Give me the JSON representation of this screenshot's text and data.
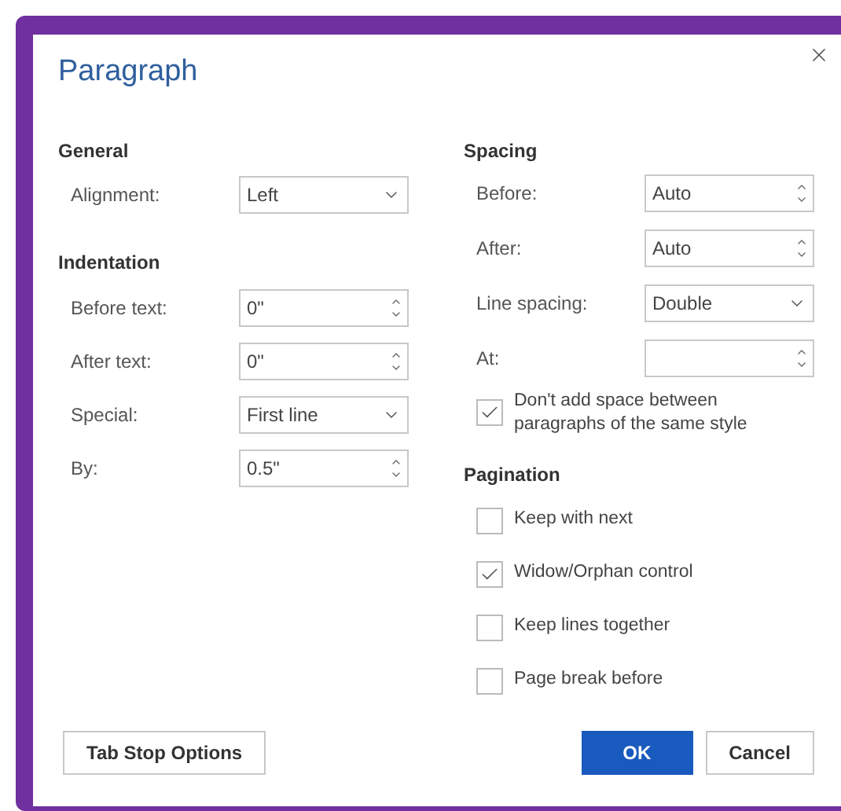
{
  "dialog": {
    "title": "Paragraph"
  },
  "general": {
    "heading": "General",
    "fields": [
      {
        "label": "Alignment:",
        "value": "Left",
        "kind": "dropdown"
      }
    ]
  },
  "indentation": {
    "heading": "Indentation",
    "fields": [
      {
        "label": "Before text:",
        "value": "0\"",
        "kind": "spin"
      },
      {
        "label": "After text:",
        "value": "0\"",
        "kind": "spin"
      },
      {
        "label": "Special:",
        "value": "First line",
        "kind": "dropdown"
      },
      {
        "label": "By:",
        "value": "0.5\"",
        "kind": "spin"
      }
    ]
  },
  "spacing": {
    "heading": "Spacing",
    "fields": [
      {
        "label": "Before:",
        "value": "Auto",
        "kind": "spin"
      },
      {
        "label": "After:",
        "value": "Auto",
        "kind": "spin"
      },
      {
        "label": "Line spacing:",
        "value": "Double",
        "kind": "dropdown"
      },
      {
        "label": "At:",
        "kind": "spin"
      }
    ],
    "option": {
      "label": "Don't add space between paragraphs of the same style",
      "checked": true
    }
  },
  "pagination": {
    "heading": "Pagination",
    "options": [
      {
        "label": "Keep with next",
        "checked": false
      },
      {
        "label": "Widow/Orphan control",
        "checked": true
      },
      {
        "label": "Keep lines together",
        "checked": false
      },
      {
        "label": "Page break before",
        "checked": false
      }
    ]
  },
  "buttons": [
    {
      "label": "Tab Stop Options",
      "kind": "secondary"
    },
    {
      "label": "OK",
      "kind": "primary"
    },
    {
      "label": "Cancel",
      "kind": "secondary"
    }
  ]
}
